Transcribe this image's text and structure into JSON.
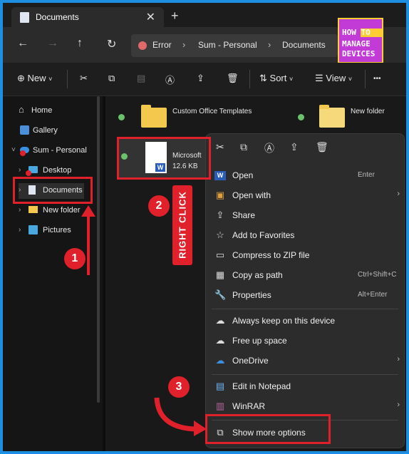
{
  "window": {
    "tab_title": "Documents",
    "tab_close": "✕",
    "new_tab": "+"
  },
  "nav": {
    "back": "←",
    "forward": "→",
    "up": "↑",
    "refresh": "↻"
  },
  "address": {
    "crumbs": [
      "Error",
      "Sum - Personal",
      "Documents"
    ],
    "separator": "›"
  },
  "logo": {
    "line1": "HOW TO",
    "line2": "MANAGE",
    "line3": "DEVICES"
  },
  "toolbar": {
    "new_label": "New",
    "sort_label": "Sort",
    "view_label": "View",
    "more": "•••"
  },
  "sidebar": {
    "items": [
      {
        "label": "Home",
        "icon": "home-icon"
      },
      {
        "label": "Gallery",
        "icon": "gallery-icon"
      },
      {
        "label": "Sum - Personal",
        "icon": "onedrive-icon"
      },
      {
        "label": "Desktop",
        "icon": "desktop-icon"
      },
      {
        "label": "Documents",
        "icon": "documents-icon"
      },
      {
        "label": "New folder",
        "icon": "folder-icon"
      },
      {
        "label": "Pictures",
        "icon": "pictures-icon"
      }
    ]
  },
  "main": {
    "folders": [
      {
        "name": "Custom Office Templates"
      },
      {
        "name": "New folder"
      }
    ],
    "file": {
      "name": "Microsoft",
      "size": "12.6 KB"
    }
  },
  "context_menu": {
    "items": [
      {
        "label": "Open",
        "shortcut": "Enter",
        "icon": "word-icon"
      },
      {
        "label": "Open with",
        "shortcut": "",
        "icon": "open-with-icon",
        "arrow": "›"
      },
      {
        "label": "Share",
        "shortcut": "",
        "icon": "share-icon"
      },
      {
        "label": "Add to Favorites",
        "shortcut": "",
        "icon": "star-icon"
      },
      {
        "label": "Compress to ZIP file",
        "shortcut": "",
        "icon": "zip-icon"
      },
      {
        "label": "Copy as path",
        "shortcut": "Ctrl+Shift+C",
        "icon": "copy-path-icon"
      },
      {
        "label": "Properties",
        "shortcut": "Alt+Enter",
        "icon": "wrench-icon"
      },
      {
        "label": "Always keep on this device",
        "shortcut": "",
        "icon": "cloud-keep-icon"
      },
      {
        "label": "Free up space",
        "shortcut": "",
        "icon": "cloud-icon"
      },
      {
        "label": "OneDrive",
        "shortcut": "",
        "icon": "onedrive-icon",
        "arrow": "›"
      },
      {
        "label": "Edit in Notepad",
        "shortcut": "",
        "icon": "notepad-icon"
      },
      {
        "label": "WinRAR",
        "shortcut": "",
        "icon": "winrar-icon",
        "arrow": "›"
      },
      {
        "label": "Show more options",
        "shortcut": "",
        "icon": "more-options-icon"
      }
    ]
  },
  "annotations": {
    "step1": "1",
    "step2": "2",
    "step3": "3",
    "right_click": "RIGHT CLICK"
  },
  "colors": {
    "accent_border": "#1e8fe0",
    "annotation_red": "#e0202a",
    "folder_yellow": "#f2c94c"
  }
}
